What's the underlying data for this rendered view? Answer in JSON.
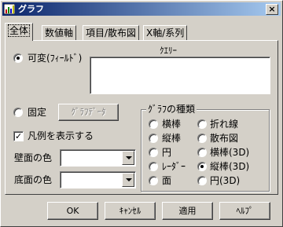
{
  "window": {
    "title": "グラフ",
    "close_label": "×"
  },
  "tabs": [
    {
      "label": "全体",
      "active": true
    },
    {
      "label": "数値軸",
      "active": false
    },
    {
      "label": "項目/散布図",
      "active": false
    },
    {
      "label": "X軸/系列",
      "active": false
    }
  ],
  "data_source": {
    "variable_label": "可変(ﾌｨｰﾙﾄﾞ)",
    "query_label": "ｸｴﾘｰ",
    "query_value": "",
    "fixed_label": "固定",
    "graph_data_button": "ｸﾞﾗﾌﾃﾞｰﾀ"
  },
  "legend": {
    "label": "凡例を表示する",
    "checked": true,
    "check_glyph": "✓"
  },
  "wall_color": {
    "label": "壁面の色",
    "value": ""
  },
  "floor_color": {
    "label": "底面の色",
    "value": ""
  },
  "graph_type": {
    "title": "ｸﾞﾗﾌの種類",
    "options": [
      {
        "label": "横棒",
        "selected": false
      },
      {
        "label": "折れ線",
        "selected": false
      },
      {
        "label": "縦棒",
        "selected": false
      },
      {
        "label": "散布図",
        "selected": false
      },
      {
        "label": "円",
        "selected": false
      },
      {
        "label": "横棒(3D)",
        "selected": false
      },
      {
        "label": "ﾚｰﾀﾞｰ",
        "selected": false
      },
      {
        "label": "縦棒(3D)",
        "selected": true
      },
      {
        "label": "面",
        "selected": false
      },
      {
        "label": "円(3D)",
        "selected": false
      }
    ]
  },
  "buttons": {
    "ok": "OK",
    "cancel": "ｷｬﾝｾﾙ",
    "apply": "適用",
    "help": "ﾍﾙﾌﾟ"
  }
}
